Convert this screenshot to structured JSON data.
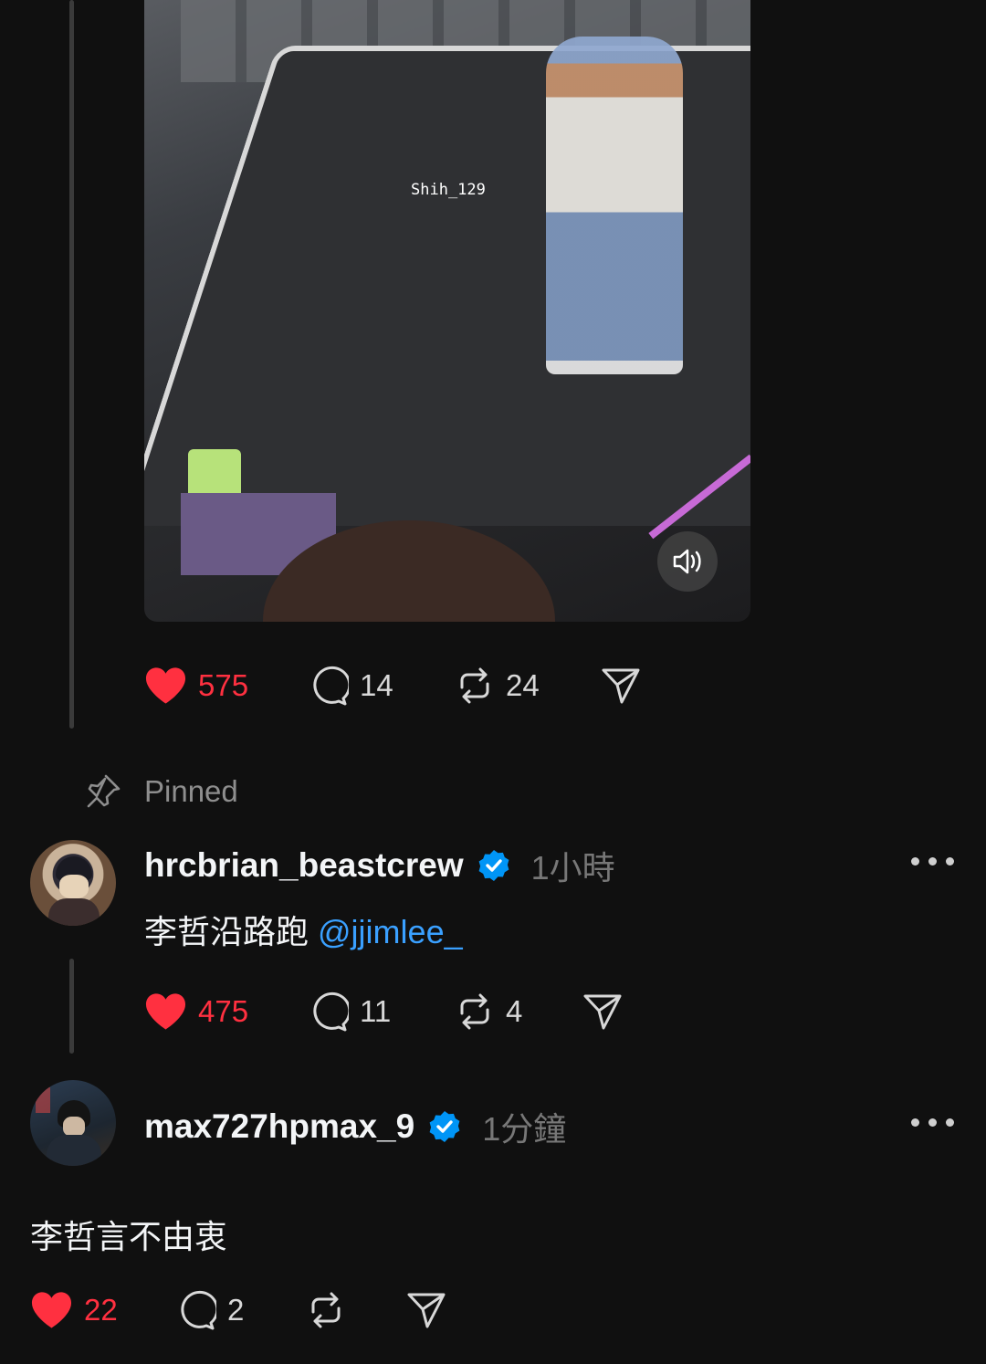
{
  "post1": {
    "media": {
      "watermark": "Shih_129",
      "sound_icon": "speaker-icon"
    },
    "actions": {
      "likes": "575",
      "comments": "14",
      "reposts": "24"
    }
  },
  "pinned_label": "Pinned",
  "reply1": {
    "username": "hrcbrian_beastcrew",
    "verified": true,
    "time": "1小時",
    "text": "李哲沿路跑 ",
    "mention": "@jjimlee_",
    "actions": {
      "likes": "475",
      "comments": "11",
      "reposts": "4"
    }
  },
  "reply2": {
    "username": "max727hpmax_9",
    "verified": true,
    "time": "1分鐘",
    "text": "李哲言不由衷",
    "actions": {
      "likes": "22",
      "comments": "2",
      "reposts": ""
    }
  },
  "colors": {
    "like": "#ff3040",
    "mention": "#3aa0ff",
    "verified": "#0095f6",
    "background": "#101010"
  }
}
